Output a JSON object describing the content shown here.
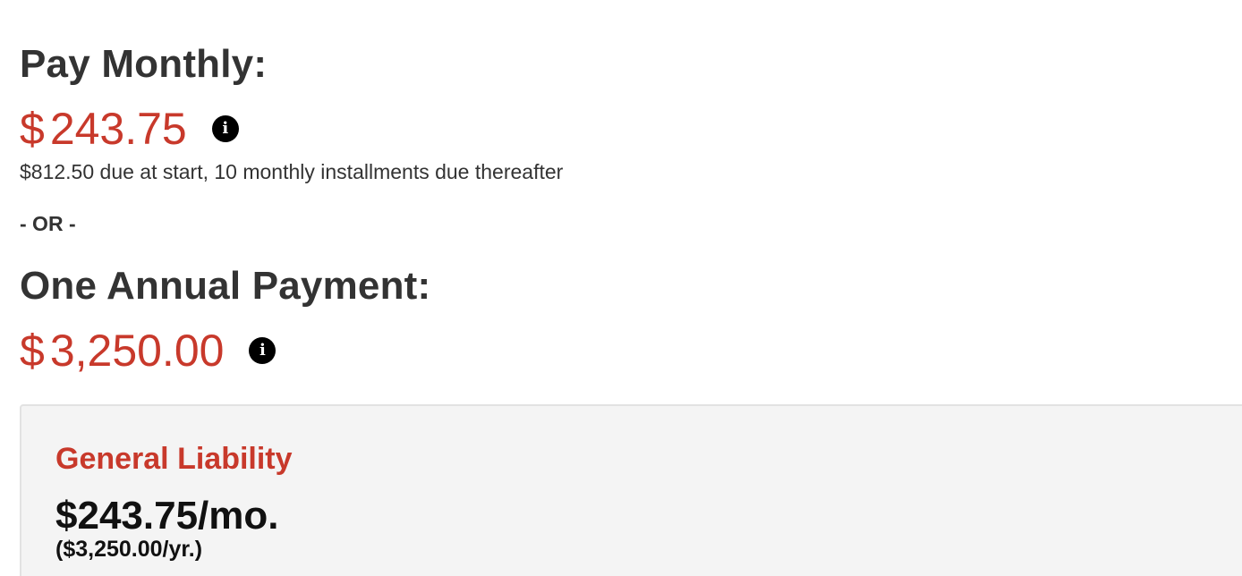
{
  "monthly": {
    "heading": "Pay Monthly:",
    "currency_symbol": "$",
    "amount": "243.75",
    "info_icon": "info-circle-icon",
    "note": "$812.50 due at start, 10 monthly installments due thereafter"
  },
  "divider": "- OR -",
  "annual": {
    "heading": "One Annual Payment:",
    "currency_symbol": "$",
    "amount": "3,250.00",
    "info_icon": "info-circle-icon"
  },
  "coverage": {
    "title": "General Liability",
    "monthly_price": "$243.75/mo.",
    "yearly_price": "($3,250.00/yr.)"
  },
  "colors": {
    "price": "#c8392b",
    "heading": "#333333",
    "card_background": "#f4f4f4"
  }
}
